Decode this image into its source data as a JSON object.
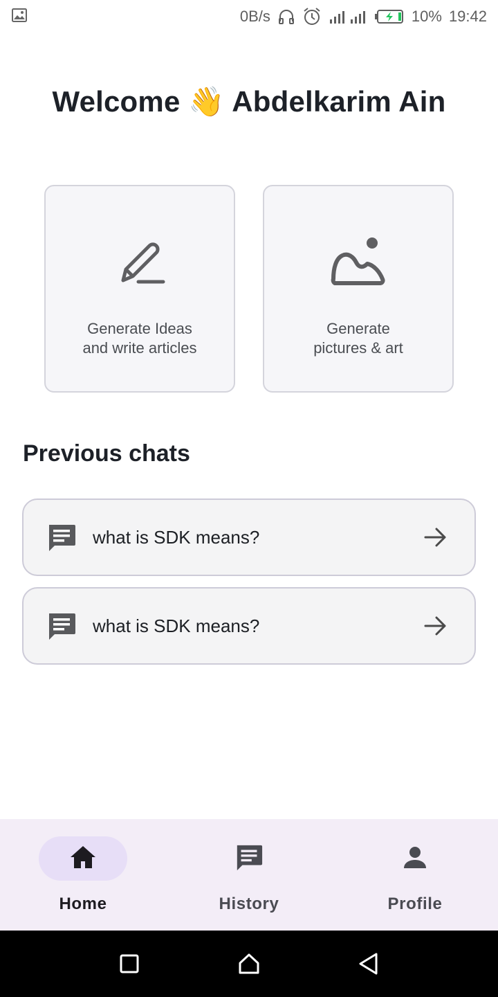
{
  "status_bar": {
    "net_speed": "0B/s",
    "battery": "10%",
    "time": "19:42"
  },
  "welcome": {
    "prefix": "Welcome",
    "emoji": "👋",
    "name": "Abdelkarim Ain"
  },
  "features": [
    {
      "label": "Generate Ideas\nand write articles",
      "icon": "pencil-icon"
    },
    {
      "label": "Generate\npictures & art",
      "icon": "image-icon"
    }
  ],
  "previous_chats": {
    "title": "Previous chats",
    "items": [
      {
        "text": "what is SDK means?"
      },
      {
        "text": "what is SDK means?"
      }
    ]
  },
  "bottom_nav": {
    "items": [
      {
        "label": "Home",
        "icon": "home-icon",
        "active": true
      },
      {
        "label": "History",
        "icon": "chat-history-icon",
        "active": false
      },
      {
        "label": "Profile",
        "icon": "person-icon",
        "active": false
      }
    ]
  },
  "colors": {
    "nav_background": "#f3edf7",
    "active_pill": "#e7def7",
    "card_background": "#f6f6f9",
    "battery_charge": "#22c55e"
  }
}
